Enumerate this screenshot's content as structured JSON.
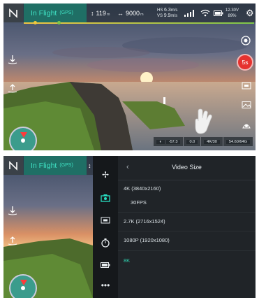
{
  "status": {
    "flight_mode": "In Flight",
    "gps": "(GPS)",
    "altitude": "119",
    "altitude_unit": "m",
    "distance": "9000",
    "distance_unit": "m",
    "hs_label": "HS",
    "hs_value": "6.3",
    "hs_unit": "m/s",
    "vs_label": "VS",
    "vs_value": "9.9",
    "vs_unit": "m/s",
    "voltage": "12.30V",
    "battery": "89%"
  },
  "camera": {
    "record_timer": "5s",
    "ev": "-57.3",
    "iso_label": "0.0",
    "resolution": "4K/30",
    "storage": "54.60/64G"
  },
  "menu": {
    "title": "Video Size",
    "back_icon": "‹",
    "options": [
      {
        "label": "4K (3840x2160)"
      },
      {
        "label": "30FPS"
      },
      {
        "label": "2.7K (2716x1524)"
      },
      {
        "label": "1080P (1920x1080)"
      },
      {
        "label": "8K"
      }
    ],
    "selected": "8K"
  },
  "colors": {
    "accent": "#28e0c3",
    "flight_bg": "#1f6f65",
    "record": "#e6322f",
    "panel": "#202428"
  },
  "icons": [
    "home-icon",
    "altitude-icon",
    "distance-icon",
    "signal-icon",
    "wifi-icon",
    "battery-icon",
    "settings-icon",
    "takeoff-icon",
    "land-icon",
    "camera-switch-icon",
    "record-button",
    "photo-mode-icon",
    "gallery-icon",
    "cam-settings-icon",
    "hand-gesture-icon",
    "fan-icon",
    "camera-icon",
    "image-icon",
    "timer-icon",
    "battery-mode-icon",
    "more-icon"
  ]
}
